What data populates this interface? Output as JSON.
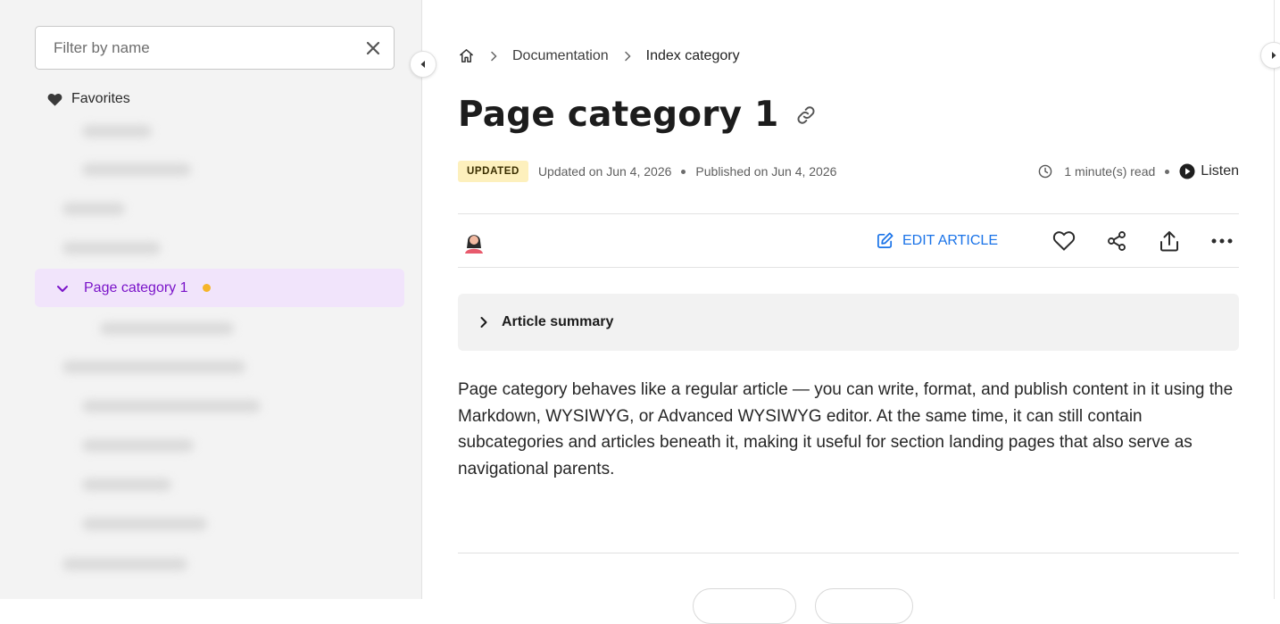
{
  "sidebar": {
    "filter": {
      "placeholder": "Filter by name",
      "value": ""
    },
    "favorites_label": "Favorites",
    "selected_item": {
      "label": "Page category 1",
      "status_color": "#f5b52a"
    }
  },
  "breadcrumb": {
    "items": [
      "Documentation",
      "Index category"
    ]
  },
  "article": {
    "title": "Page category 1",
    "badge": "UPDATED",
    "updated": "Updated on Jun 4, 2026",
    "published": "Published on Jun 4, 2026",
    "read_time": "1 minute(s) read",
    "listen_label": "Listen",
    "edit_label": "EDIT ARTICLE",
    "summary_label": "Article summary",
    "body": "Page category behaves like a regular article — you can write, format, and publish content in it using the Markdown, WYSIWYG, or Advanced WYSIWYG editor. At the same time, it can still contain subcategories and articles beneath it, making it useful for section landing pages that also serve as navigational parents."
  },
  "colors": {
    "accent": "#1a73e8",
    "selected_bg": "#f1e4fb",
    "selected_text": "#7a13c9",
    "badge_bg": "#fdf0bd"
  }
}
